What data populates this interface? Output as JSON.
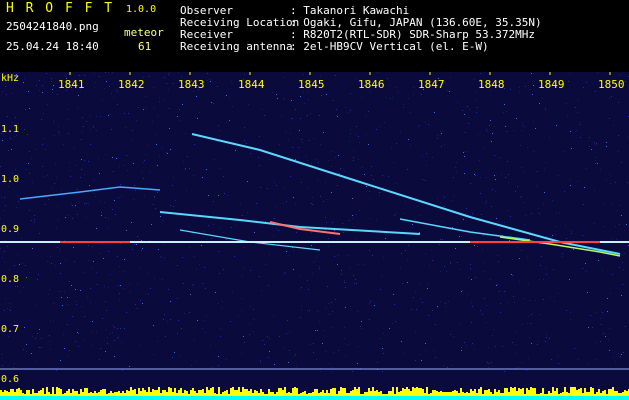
{
  "app": {
    "name": "H R O F F T",
    "version": "1.0.0",
    "filename": "2504241840.png",
    "datetime": "25.04.24 18:40",
    "meteor_label": "meteor",
    "meteor_count": "61"
  },
  "info": {
    "rows": [
      {
        "label": "Observer",
        "value": ": Takanori Kawachi"
      },
      {
        "label": "Receiving Location",
        "value": ": Ogaki, Gifu, JAPAN (136.60E, 35.35N)"
      },
      {
        "label": "Receiver",
        "value": ": R820T2(RTL-SDR) SDR-Sharp 53.372MHz"
      },
      {
        "label": "Receiving antenna",
        "value": ": 2el-HB9CV Vertical (el. E-W)"
      }
    ]
  },
  "axes": {
    "y_unit": "kHz",
    "x_ticks": [
      "1841",
      "1842",
      "1843",
      "1844",
      "1845",
      "1846",
      "1847",
      "1848",
      "1849",
      "1850"
    ],
    "y_ticks": [
      "1.1",
      "1.0",
      "0.9",
      "0.8",
      "0.7",
      "0.6"
    ]
  },
  "colors": {
    "background": "#0a0a3c",
    "noise": "#1a2a9a",
    "trail": "#58d8ff",
    "carrier": "#ff4040",
    "baseline": "#ffff00",
    "baseline_low": "#00ffff"
  }
}
